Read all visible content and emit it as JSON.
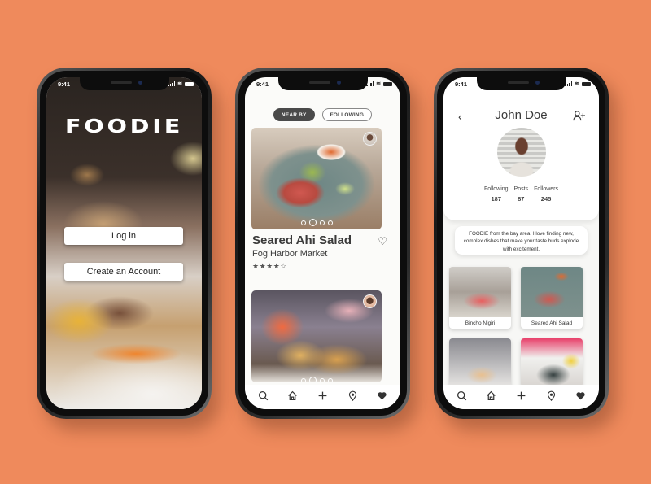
{
  "background_color": "#ef8a5c",
  "status_bar": {
    "time": "9:41"
  },
  "screens": {
    "login": {
      "logo": "FOODIE",
      "login_button": "Log in",
      "create_account_button": "Create an Account"
    },
    "feed": {
      "tabs": [
        {
          "label": "NEAR BY",
          "active": true
        },
        {
          "label": "FOLLOWING",
          "active": false
        }
      ],
      "posts": [
        {
          "title": "Seared Ahi Salad",
          "place": "Fog Harbor Market",
          "rating": "★★★★☆",
          "rating_value": 4,
          "rating_max": 5,
          "carousel_total": 4,
          "carousel_active": 2
        },
        {
          "carousel_total": 4,
          "carousel_active": 2
        }
      ]
    },
    "profile": {
      "back_icon": "‹",
      "name": "John Doe",
      "stats": [
        {
          "label": "Following",
          "value": "187"
        },
        {
          "label": "Posts",
          "value": "87"
        },
        {
          "label": "Followers",
          "value": "245"
        }
      ],
      "bio": "FOODIE from the bay area. I love finding new, complex dishes that make your taste buds explode with excitement.",
      "grid": [
        {
          "label": "Bincho Nigiri"
        },
        {
          "label": "Seared Ahi Salad"
        },
        {
          "label": ""
        },
        {
          "label": ""
        }
      ]
    }
  },
  "bottom_nav": [
    {
      "icon": "search-icon"
    },
    {
      "icon": "home-icon"
    },
    {
      "icon": "plus-icon"
    },
    {
      "icon": "location-pin-icon"
    },
    {
      "icon": "heart-icon"
    }
  ]
}
